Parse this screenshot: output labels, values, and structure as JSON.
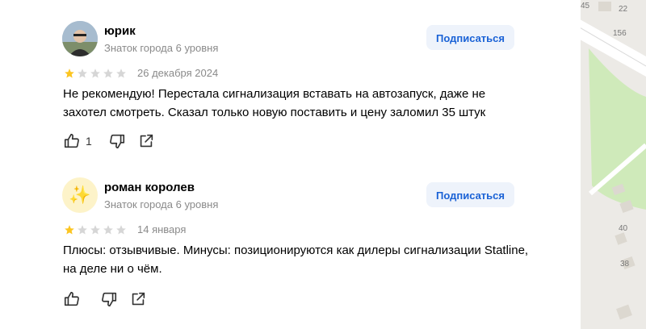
{
  "reviews": [
    {
      "author": "юрик",
      "badge": "Знаток города 6 уровня",
      "subscribe_label": "Подписаться",
      "rating": 1,
      "date": "26 декабря 2024",
      "text": "Не рекомендую! Перестала сигнализация вставать на автозапуск, даже не захотел смотреть. Сказал только новую поставить и цену заломил 35 штук",
      "likes": "1",
      "avatar": "user-photo"
    },
    {
      "author": "роман королев",
      "badge": "Знаток города 6 уровня",
      "subscribe_label": "Подписаться",
      "rating": 1,
      "date": "14 января",
      "text": "Плюсы: отзывчивые. Минусы: позиционируются как дилеры сигнализации Statline, на деле ни о чём.",
      "likes": "",
      "avatar": "sparkles-icon"
    }
  ],
  "map": {
    "labels": [
      "45",
      "22",
      "156",
      "40",
      "38"
    ]
  },
  "colors": {
    "star_filled": "#fcc521",
    "star_empty": "#d6d6d6",
    "accent": "#1a62d6",
    "map_green": "#cfeaba"
  }
}
